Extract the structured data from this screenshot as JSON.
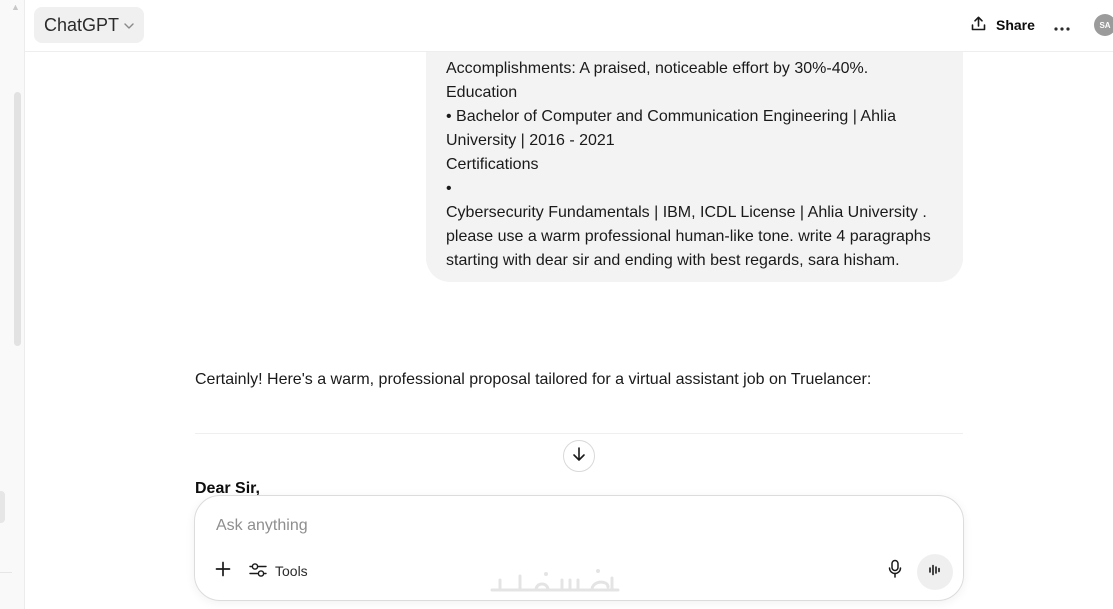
{
  "header": {
    "model_label": "ChatGPT",
    "share_label": "Share",
    "avatar_initials": "SA"
  },
  "user_message": {
    "lines": [
      "Accomplishments: A praised, noticeable effort by 30%-40%.",
      "Education",
      "• Bachelor of Computer and Communication Engineering | Ahlia",
      "University | 2016 - 2021",
      "Certifications",
      "•",
      "Cybersecurity Fundamentals | IBM, ICDL License | Ahlia University .",
      "please use a warm professional human-like tone. write 4 paragraphs",
      "starting with dear sir and ending with best regards, sara hisham."
    ]
  },
  "assistant_message": {
    "intro": "Certainly! Here's a warm, professional proposal tailored for a virtual assistant job on Truelancer:",
    "salutation": "Dear Sir,"
  },
  "composer": {
    "placeholder": "Ask anything",
    "tools_label": "Tools"
  },
  "icons": {
    "model_chevron": "chevron-down-icon",
    "share": "share-icon",
    "more": "more-horizontal-icon",
    "scroll_down": "arrow-down-icon",
    "plus": "plus-icon",
    "tools": "sliders-icon",
    "mic": "microphone-icon",
    "voice": "voice-waveform-icon"
  },
  "colors": {
    "bubble_bg": "#f3f3f3",
    "avatar_bg": "#9b9b9b",
    "voice_btn_bg": "#efefef"
  }
}
